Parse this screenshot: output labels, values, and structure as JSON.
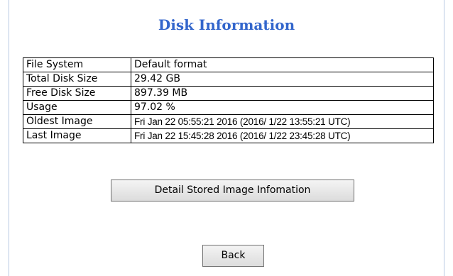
{
  "page": {
    "title": "Disk Information"
  },
  "disk_info": {
    "rows": [
      {
        "label": "File System",
        "value": "Default format"
      },
      {
        "label": "Total Disk Size",
        "value": " 29.42 GB"
      },
      {
        "label": "Free Disk Size",
        "value": " 897.39 MB"
      },
      {
        "label": "Usage",
        "value": " 97.02 %"
      },
      {
        "label": "Oldest Image",
        "value": "Fri Jan 22 05:55:21 2016 (2016/ 1/22 13:55:21 UTC)"
      },
      {
        "label": "Last Image",
        "value": "Fri Jan 22 15:45:28 2016 (2016/ 1/22 23:45:28 UTC)"
      }
    ]
  },
  "buttons": {
    "detail_label": "Detail Stored Image Infomation",
    "back_label": "Back"
  },
  "colors": {
    "title": "#3366cc",
    "frame_border": "#b9c9e3"
  }
}
